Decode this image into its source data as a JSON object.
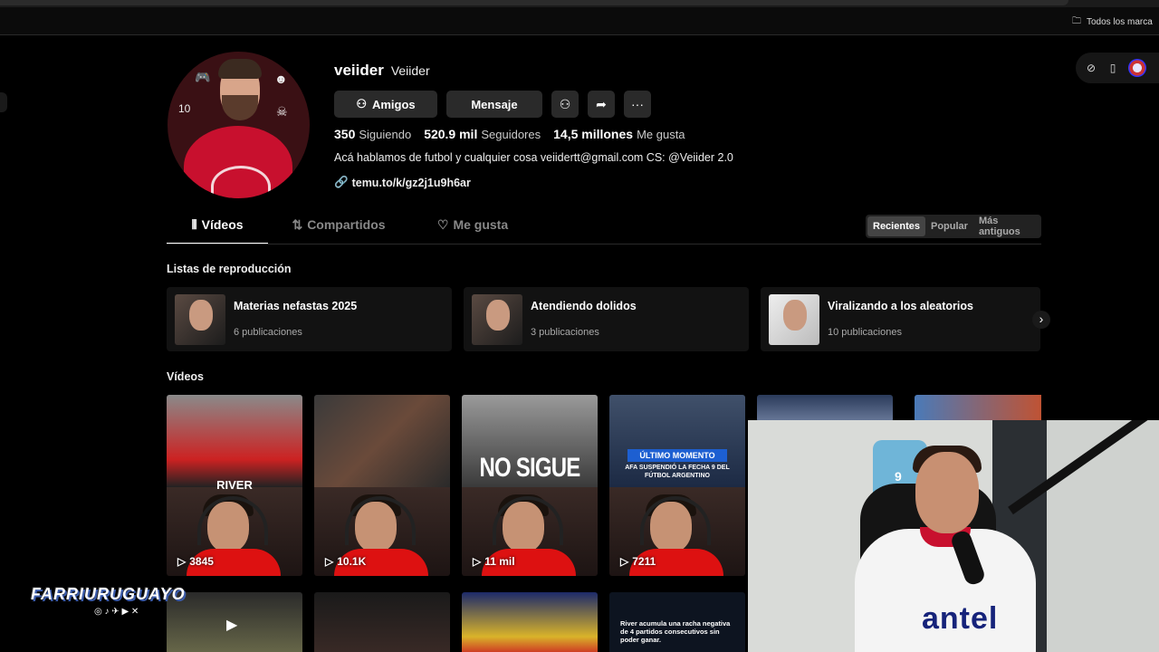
{
  "browser": {
    "bookmarks_label": "Todos los marca"
  },
  "profile": {
    "username": "veiider",
    "display_name": "Veiider",
    "buttons": {
      "friends": "Amigos",
      "message": "Mensaje"
    },
    "stats": [
      {
        "value": "350",
        "label": "Siguiendo"
      },
      {
        "value": "520.9 mil",
        "label": "Seguidores"
      },
      {
        "value": "14,5 millones",
        "label": "Me gusta"
      }
    ],
    "bio": "Acá hablamos de futbol y cualquier cosa veiidertt@gmail.com CS: @Veiider 2.0",
    "link": "temu.to/k/gz2j1u9h6ar"
  },
  "tabs": [
    {
      "label": "Vídeos",
      "icon": "grid-icon",
      "active": true
    },
    {
      "label": "Compartidos",
      "icon": "repost-icon",
      "active": false
    },
    {
      "label": "Me gusta",
      "icon": "heart-icon",
      "active": false
    }
  ],
  "sort": {
    "options": [
      "Recientes",
      "Popular",
      "Más antiguos"
    ],
    "selected": "Recientes"
  },
  "playlists": {
    "heading": "Listas de reproducción",
    "items": [
      {
        "title": "Materias nefastas 2025",
        "count": "6 publicaciones"
      },
      {
        "title": "Atendiendo dolidos",
        "count": "3 publicaciones"
      },
      {
        "title": "Viralizando a los aleatorios",
        "count": "10 publicaciones"
      }
    ]
  },
  "videos": {
    "heading": "Vídeos",
    "items": [
      {
        "caption": "RIVER",
        "views": "3845"
      },
      {
        "caption": "",
        "views": "10.1K"
      },
      {
        "caption": "NO SIGUE",
        "views": "11 mil"
      },
      {
        "caption": "ÚLTIMO MOMENTO",
        "subcaption": "AFA SUSPENDIÓ LA FECHA 9 DEL FÚTBOL ARGENTINO",
        "views": "7211"
      }
    ],
    "row2": [
      {
        "caption": ""
      },
      {
        "caption": ""
      },
      {
        "caption": ""
      },
      {
        "caption": "River acumula una racha negativa de 4 partidos consecutivos sin poder ganar."
      }
    ]
  },
  "overlay": {
    "watermark": "FARRIURUGUAYO",
    "camera_shirt_text": "antel",
    "jersey_number": "9"
  },
  "colors": {
    "background": "#000000",
    "button": "#2a2a2a",
    "river_red": "#c8102e"
  }
}
